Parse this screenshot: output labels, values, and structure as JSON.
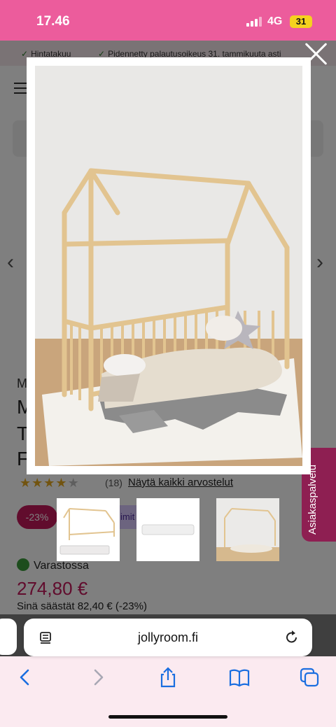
{
  "status_bar": {
    "time": "17.46",
    "network": "4G",
    "battery": "31"
  },
  "page": {
    "usp": [
      "Hintatakuu",
      "Pidennetty palautusoikeus 31. tammikuuta asti"
    ],
    "brand_initial": "M",
    "title_initials": [
      "M",
      "T",
      "F"
    ],
    "rating": {
      "stars": 4,
      "max": 5,
      "count": "(18)",
      "link": "Näytä kaikki arvostelut"
    },
    "discount_badge": "-23%",
    "limited_badge": "imit",
    "stock": "Varastossa",
    "price": "274,80 €",
    "savings": "Sinä säästät 82,40 € (-23%)"
  },
  "side_tab": {
    "label": "Asiakaspalvelu"
  },
  "browser": {
    "url": "jollyroom.fi"
  },
  "colors": {
    "brand_pink": "#ec5c9c",
    "price": "#c2185b",
    "side_tab": "#8e1f52"
  }
}
